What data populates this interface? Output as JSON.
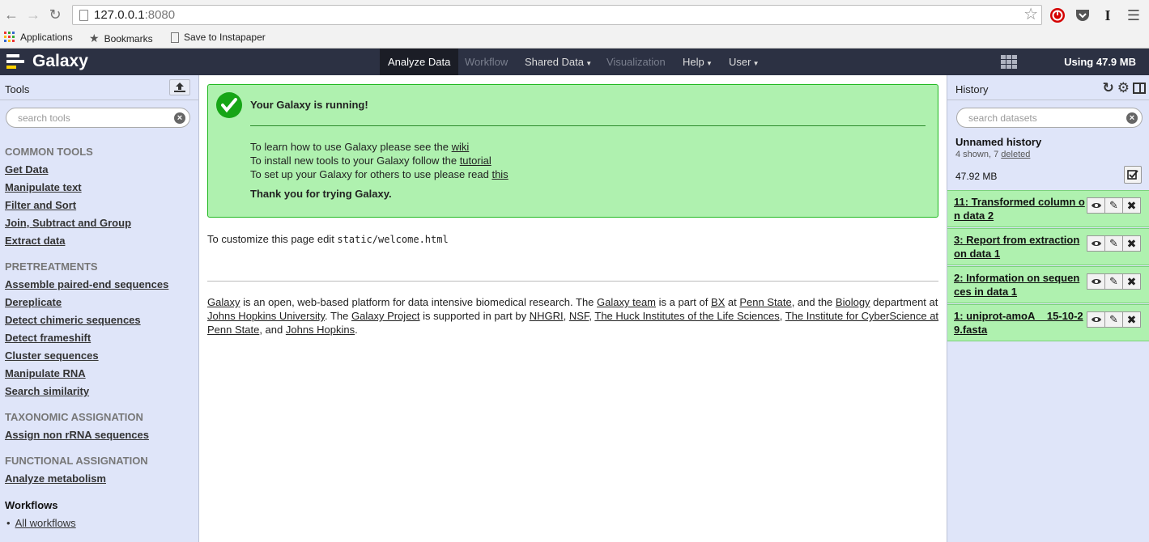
{
  "browser": {
    "url_host": "127.0.0.1",
    "url_port": ":8080",
    "bookmarks": [
      {
        "label": "Applications"
      },
      {
        "label": "Bookmarks"
      },
      {
        "label": "Save to Instapaper"
      }
    ]
  },
  "masthead": {
    "brand": "Galaxy",
    "tabs": [
      {
        "label": "Analyze Data"
      },
      {
        "label": "Workflow"
      },
      {
        "label": "Shared Data"
      },
      {
        "label": "Visualization"
      },
      {
        "label": "Help"
      },
      {
        "label": "User"
      }
    ],
    "quota": "Using 47.9 MB"
  },
  "tools_panel": {
    "title": "Tools",
    "search_placeholder": "search tools",
    "sections": [
      {
        "name": "COMMON TOOLS",
        "tools": [
          "Get Data",
          "Manipulate text",
          "Filter and Sort",
          "Join, Subtract and Group",
          "Extract data"
        ]
      },
      {
        "name": "PRETREATMENTS",
        "tools": [
          "Assemble paired-end sequences",
          "Dereplicate",
          "Detect chimeric sequences",
          "Detect frameshift",
          "Cluster sequences",
          "Manipulate RNA",
          "Search similarity"
        ]
      },
      {
        "name": "TAXONOMIC ASSIGNATION",
        "tools": [
          "Assign non rRNA sequences"
        ]
      },
      {
        "name": "FUNCTIONAL ASSIGNATION",
        "tools": [
          "Analyze metabolism"
        ]
      }
    ],
    "workflows_title": "Workflows",
    "workflows_link": "All workflows"
  },
  "center": {
    "done_title": "Your Galaxy is running!",
    "line1_text": "To learn how to use Galaxy please see the ",
    "line1_link": "wiki",
    "line2_text": "To install new tools to your Galaxy follow the ",
    "line2_link": "tutorial",
    "line3_text": "To set up your Galaxy for others to use please read ",
    "line3_link": "this",
    "thanks": "Thank you for trying Galaxy.",
    "customize_text": "To customize this page edit ",
    "customize_code": "static/welcome.html",
    "about": {
      "galaxy": "Galaxy",
      "t1": " is an open, web-based platform for data intensive biomedical research. The ",
      "galaxy_team": "Galaxy team",
      "t2": " is a part of ",
      "bx": "BX",
      "t3": " at ",
      "penn_state": "Penn State",
      "t4": ", and the ",
      "biology": "Biology",
      "t5": " department at ",
      "jhu": "Johns Hopkins University",
      "t6": ". The ",
      "galaxy_project": "Galaxy Project",
      "t7": " is supported in part by ",
      "nhgri": "NHGRI",
      "t8": ", ",
      "nsf": "NSF",
      "t9": ", ",
      "huck": "The Huck Institutes of the Life Sciences",
      "t10": ", ",
      "ics": "The Institute for CyberScience at Penn State",
      "t11": ", and ",
      "jh": "Johns Hopkins",
      "t12": "."
    }
  },
  "history_panel": {
    "title": "History",
    "search_placeholder": "search datasets",
    "name": "Unnamed history",
    "shown_text": "4 shown, 7 ",
    "deleted_link": "deleted",
    "size": "47.92 MB",
    "datasets": [
      {
        "title": "11: Transformed column on data 2"
      },
      {
        "title": "3: Report from extraction on data 1"
      },
      {
        "title": "2: Information on sequences in data 1"
      },
      {
        "title": "1: uniprot-amoA__15-10-29.fasta"
      }
    ]
  },
  "colors": {
    "masthead": "#2c3143",
    "panel": "#dfe5f9",
    "ok_bg": "#aff1af",
    "ok_border": "#20b820"
  }
}
